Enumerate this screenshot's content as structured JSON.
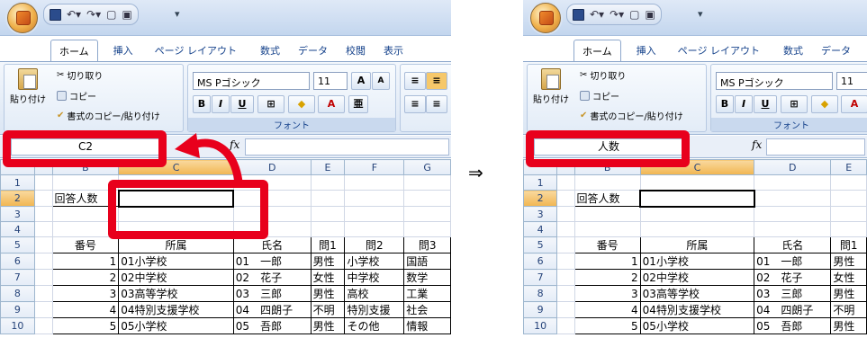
{
  "ribbon": {
    "tabs": [
      "ホーム",
      "挿入",
      "ページ レイアウト",
      "数式",
      "データ",
      "校閲",
      "表示"
    ],
    "clipboard": {
      "paste": "貼り付け",
      "cut": "切り取り",
      "copy": "コピー",
      "format_painter": "書式のコピー/貼り付け"
    },
    "font": {
      "name": "MS Pゴシック",
      "size": "11",
      "group_label": "フォント",
      "grow": "A",
      "shrink": "A",
      "bold": "B",
      "italic": "I",
      "underline": "U"
    }
  },
  "fx_label": "fx",
  "left": {
    "name_box": "C2"
  },
  "right": {
    "name_box": "人数"
  },
  "arrow_symbol": "⇒",
  "sheet": {
    "columns_left": [
      "",
      "B",
      "C",
      "D",
      "E",
      "F",
      "G"
    ],
    "columns_right": [
      "",
      "B",
      "C",
      "D",
      "E"
    ],
    "row_numbers": [
      "1",
      "2",
      "3",
      "4",
      "5",
      "6",
      "7",
      "8",
      "9",
      "10"
    ],
    "respondents_label": "回答人数",
    "headers": {
      "no": "番号",
      "affiliation": "所属",
      "name": "氏名",
      "q1": "問1",
      "q2": "問2",
      "q3": "問3"
    },
    "rows": [
      {
        "no": "1",
        "affiliation": "01小学校",
        "name": "01　一郎",
        "q1": "男性",
        "q2": "小学校",
        "q3": "国語"
      },
      {
        "no": "2",
        "affiliation": "02中学校",
        "name": "02　花子",
        "q1": "女性",
        "q2": "中学校",
        "q3": "数学"
      },
      {
        "no": "3",
        "affiliation": "03高等学校",
        "name": "03　三郎",
        "q1": "男性",
        "q2": "高校",
        "q3": "工業"
      },
      {
        "no": "4",
        "affiliation": "04特別支援学校",
        "name": "04　四朗子",
        "q1": "不明",
        "q2": "特別支援",
        "q3": "社会"
      },
      {
        "no": "5",
        "affiliation": "05小学校",
        "name": "05　吾郎",
        "q1": "男性",
        "q2": "その他",
        "q3": "情報"
      }
    ]
  },
  "colors": {
    "highlight": "#e8001c",
    "selected_header": "#f1b650"
  }
}
